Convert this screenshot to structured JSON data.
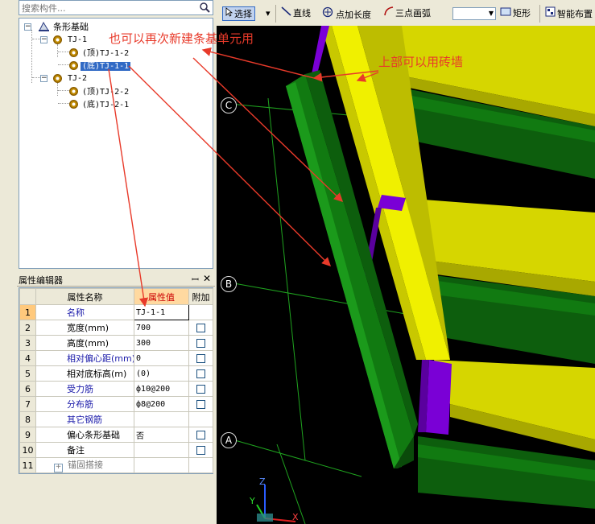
{
  "search": {
    "placeholder": "搜索构件..."
  },
  "tree": {
    "root": "条形基础",
    "groups": [
      {
        "label": "TJ-1",
        "children": [
          "(顶)TJ-1-2",
          "(底)TJ-1-1"
        ]
      },
      {
        "label": "TJ-2",
        "children": [
          "(顶)TJ-2-2",
          "(底)TJ-2-1"
        ]
      }
    ],
    "selected": "(底)TJ-1-1"
  },
  "props": {
    "title": "属性编辑器",
    "pin": "ꟷ",
    "close": "✕",
    "columns": [
      "属性名称",
      "属性值",
      "附加"
    ],
    "rows": [
      {
        "num": "1",
        "name": "名称",
        "value": "TJ-1-1",
        "style": "blue"
      },
      {
        "num": "2",
        "name": "宽度(mm)",
        "value": "700",
        "style": "normal",
        "check": true
      },
      {
        "num": "3",
        "name": "高度(mm)",
        "value": "300",
        "style": "normal",
        "check": true
      },
      {
        "num": "4",
        "name": "相对偏心距(mm)",
        "value": "0",
        "style": "blue",
        "check": true
      },
      {
        "num": "5",
        "name": "相对底标高(m)",
        "value": "(0)",
        "style": "normal",
        "check": true
      },
      {
        "num": "6",
        "name": "受力筋",
        "value": "ф10@200",
        "style": "blue",
        "check": true
      },
      {
        "num": "7",
        "name": "分布筋",
        "value": "ф8@200",
        "style": "blue",
        "check": true
      },
      {
        "num": "8",
        "name": "其它钢筋",
        "value": "",
        "style": "blue"
      },
      {
        "num": "9",
        "name": "偏心条形基础",
        "value": "否",
        "style": "normal",
        "check": true
      },
      {
        "num": "10",
        "name": "备注",
        "value": "",
        "style": "normal",
        "check": true
      },
      {
        "num": "11",
        "name": "锚固搭接",
        "value": "",
        "style": "gray",
        "expandable": true
      }
    ]
  },
  "toolbar": {
    "select": "选择",
    "line": "直线",
    "point_length": "点加长度",
    "three_point_arc": "三点画弧",
    "rect": "矩形",
    "smart_layout": "智能布置"
  },
  "viewport": {
    "axis_labels": [
      "C",
      "B",
      "A"
    ],
    "axes": {
      "z": "Z",
      "y": "Y",
      "x": "X"
    }
  },
  "annotations": {
    "note1": "也可以再次新建条基单元用",
    "note2": "上部可以用砖墙"
  },
  "colors": {
    "brick_wall": "#d6d600",
    "foundation": "#117a11",
    "column": "#7a00d6",
    "annotation": "#e83a2a",
    "grid": "#1fa31f"
  }
}
